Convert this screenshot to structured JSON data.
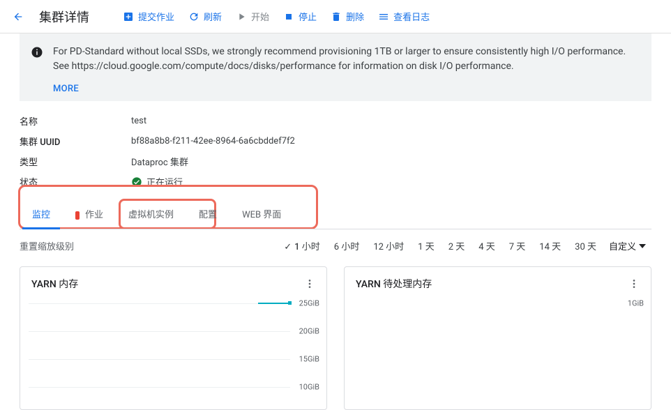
{
  "header": {
    "title": "集群详情",
    "actions": {
      "submit": "提交作业",
      "refresh": "刷新",
      "start": "开始",
      "stop": "停止",
      "delete": "删除",
      "logs": "查看日志"
    }
  },
  "banner": {
    "text": "For PD-Standard without local SSDs, we strongly recommend provisioning 1TB or larger to ensure consistently high I/O performance. See https://cloud.google.com/compute/docs/disks/performance for information on disk I/O performance.",
    "more": "MORE"
  },
  "details": {
    "name_label": "名称",
    "name_value": "test",
    "uuid_label": "集群 UUID",
    "uuid_value": "bf88a8b8-f211-42ee-8964-6a6cbddef7f2",
    "type_label": "类型",
    "type_value": "Dataproc 集群",
    "status_label": "状态",
    "status_value": "正在运行"
  },
  "tabs": {
    "monitor": "监控",
    "jobs": "作业",
    "vms": "虚拟机实例",
    "config": "配置",
    "web": "WEB 界面"
  },
  "zoom": {
    "reset": "重置缩放级别",
    "ranges": {
      "h1": "1 小时",
      "h6": "6 小时",
      "h12": "12 小时",
      "d1": "1 天",
      "d2": "2 天",
      "d4": "4 天",
      "d7": "7 天",
      "d14": "14 天",
      "d30": "30 天"
    },
    "custom": "自定义"
  },
  "charts": {
    "yarn_mem": {
      "title": "YARN 内存",
      "ticks": {
        "t0": "25GiB",
        "t1": "20GiB",
        "t2": "15GiB",
        "t3": "10GiB"
      }
    },
    "yarn_pending": {
      "title": "YARN 待处理内存",
      "ticks": {
        "t0": "1GiB"
      }
    }
  },
  "chart_data": [
    {
      "type": "line",
      "title": "YARN 内存",
      "ylabel": "GiB",
      "ylim": [
        0,
        25
      ],
      "ticks": [
        10,
        15,
        20,
        25
      ],
      "series": [
        {
          "name": "YARN 内存",
          "values": [
            25
          ]
        }
      ]
    },
    {
      "type": "line",
      "title": "YARN 待处理内存",
      "ylabel": "GiB",
      "ylim": [
        0,
        1
      ],
      "ticks": [
        1
      ],
      "series": [
        {
          "name": "待处理",
          "values": []
        }
      ]
    }
  ]
}
